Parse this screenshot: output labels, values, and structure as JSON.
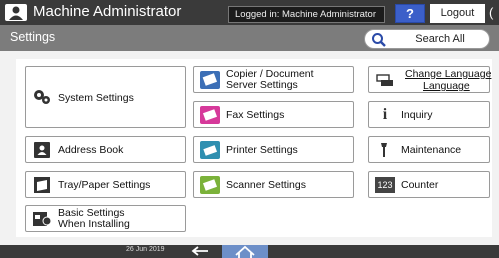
{
  "header": {
    "user_title": "Machine Administrator",
    "logged_in": "Logged in: Machine Administrator",
    "help_label": "?",
    "logout_label": "Logout"
  },
  "subheader": {
    "page_title": "Settings",
    "search_label": "Search All"
  },
  "tiles": {
    "system_settings": "System Settings",
    "copier_line1": "Copier / Document",
    "copier_line2": "Server Settings",
    "fax_settings": "Fax Settings",
    "change_language_line1": "Change Language",
    "change_language_line2": "Language",
    "inquiry": "Inquiry",
    "address_book": "Address Book",
    "printer_settings": "Printer Settings",
    "maintenance": "Maintenance",
    "tray_paper": "Tray/Paper Settings",
    "scanner_settings": "Scanner Settings",
    "counter": "Counter",
    "basic_line1": "Basic Settings",
    "basic_line2": "When Installing"
  },
  "footer": {
    "date": "26 Jun 2019"
  },
  "colors": {
    "header_bg": "#3a3a3a",
    "subheader_bg": "#7c7c7c",
    "help_blue": "#3b5fc9",
    "home_blue": "#6d8fc8"
  },
  "icons": {
    "user": "user-icon",
    "search": "search-icon",
    "system": "gears-icon",
    "copier": "copier-icon",
    "fax": "fax-icon",
    "language": "language-icon",
    "inquiry": "info-icon",
    "address_book": "address-book-icon",
    "printer": "printer-icon",
    "maintenance": "wrench-icon",
    "tray": "tray-icon",
    "scanner": "scanner-icon",
    "counter": "counter-icon",
    "basic": "basic-settings-icon",
    "back": "back-arrow-icon",
    "home": "home-icon"
  }
}
